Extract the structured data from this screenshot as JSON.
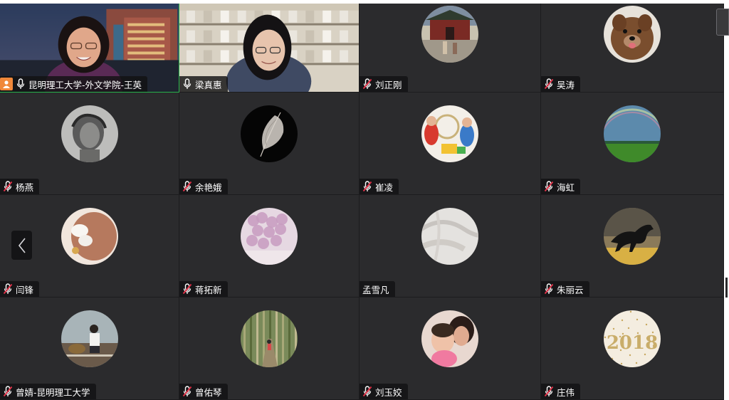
{
  "participants": [
    {
      "name": "昆明理工大学-外文学院-王英",
      "mic": "active",
      "video": true,
      "host": true,
      "speaking": true,
      "image": "woman with glasses in front of campus buildings at dusk"
    },
    {
      "name": "梁真惠",
      "mic": "active",
      "video": true,
      "host": false,
      "speaking": false,
      "image": "woman with glasses in a room with bookshelves"
    },
    {
      "name": "刘正刚",
      "mic": "muted",
      "video": false,
      "image": "traditional chinese gate with people"
    },
    {
      "name": "吴涛",
      "mic": "muted",
      "video": false,
      "image": "fluffy brown puppy"
    },
    {
      "name": "杨燕",
      "mic": "muted",
      "video": false,
      "image": "black and white bust sculpture"
    },
    {
      "name": "余艳娥",
      "mic": "muted",
      "video": false,
      "image": "white feather on dark background"
    },
    {
      "name": "崔凌",
      "mic": "muted",
      "video": false,
      "image": "children playing with toys"
    },
    {
      "name": "海虹",
      "mic": "muted",
      "video": false,
      "image": "rainbow over green field"
    },
    {
      "name": "闫锋",
      "mic": "muted",
      "video": false,
      "image": "hair with white bow"
    },
    {
      "name": "蒋拓新",
      "mic": "muted",
      "video": false,
      "image": "pink lilac flowers"
    },
    {
      "name": "孟雪凡",
      "mic": "none",
      "video": false,
      "image": "white fabric"
    },
    {
      "name": "朱丽云",
      "mic": "muted",
      "video": false,
      "image": "black horse galloping"
    },
    {
      "name": "曾婧-昆明理工大学",
      "mic": "muted",
      "video": false,
      "image": "person sitting with dog on road"
    },
    {
      "name": "曾佑琴",
      "mic": "muted",
      "video": false,
      "image": "person walking in bamboo forest"
    },
    {
      "name": "刘玉姣",
      "mic": "muted",
      "video": false,
      "image": "mother and baby"
    },
    {
      "name": "庄伟",
      "mic": "muted",
      "video": false,
      "image": "2018 gold glitter"
    }
  ],
  "icons": {
    "mic_active": "microphone-icon",
    "mic_muted": "microphone-muted-icon",
    "host": "host-person-icon",
    "prev": "chevron-left-icon"
  },
  "colors": {
    "tile_bg": "#2b2b2d",
    "speaking_border": "#27b24a",
    "mute_slash": "#e8344b",
    "host_badge": "#f0883a"
  }
}
